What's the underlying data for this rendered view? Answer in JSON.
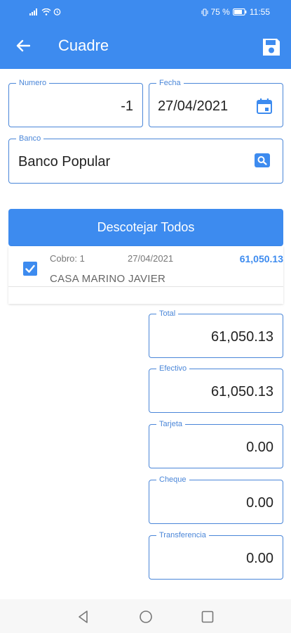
{
  "status_bar": {
    "battery_percent": "75 %",
    "time": "11:55"
  },
  "toolbar": {
    "title": "Cuadre",
    "back_icon": "arrow-left-icon",
    "save_icon": "floppy-disk-icon"
  },
  "form": {
    "numero": {
      "label": "Numero",
      "value": "-1"
    },
    "fecha": {
      "label": "Fecha",
      "value": "27/04/2021",
      "icon": "calendar-icon"
    },
    "banco": {
      "label": "Banco",
      "value": "Banco Popular",
      "icon": "search-icon"
    }
  },
  "actions": {
    "descotejar_label": "Descotejar Todos"
  },
  "list": {
    "items": [
      {
        "checked": true,
        "cobro": "Cobro: 1",
        "date": "27/04/2021",
        "amount": "61,050.13",
        "client": "CASA MARINO JAVIER"
      }
    ]
  },
  "totals": {
    "total": {
      "label": "Total",
      "value": "61,050.13"
    },
    "efectivo": {
      "label": "Efectivo",
      "value": "61,050.13"
    },
    "tarjeta": {
      "label": "Tarjeta",
      "value": "0.00"
    },
    "cheque": {
      "label": "Cheque",
      "value": "0.00"
    },
    "transferencia": {
      "label": "Transferencia",
      "value": "0.00"
    }
  },
  "colors": {
    "primary": "#3d8bef",
    "border": "#4a86d8"
  },
  "nav_bar": {
    "icons": [
      "back-triangle-icon",
      "home-circle-icon",
      "recents-square-icon"
    ]
  }
}
